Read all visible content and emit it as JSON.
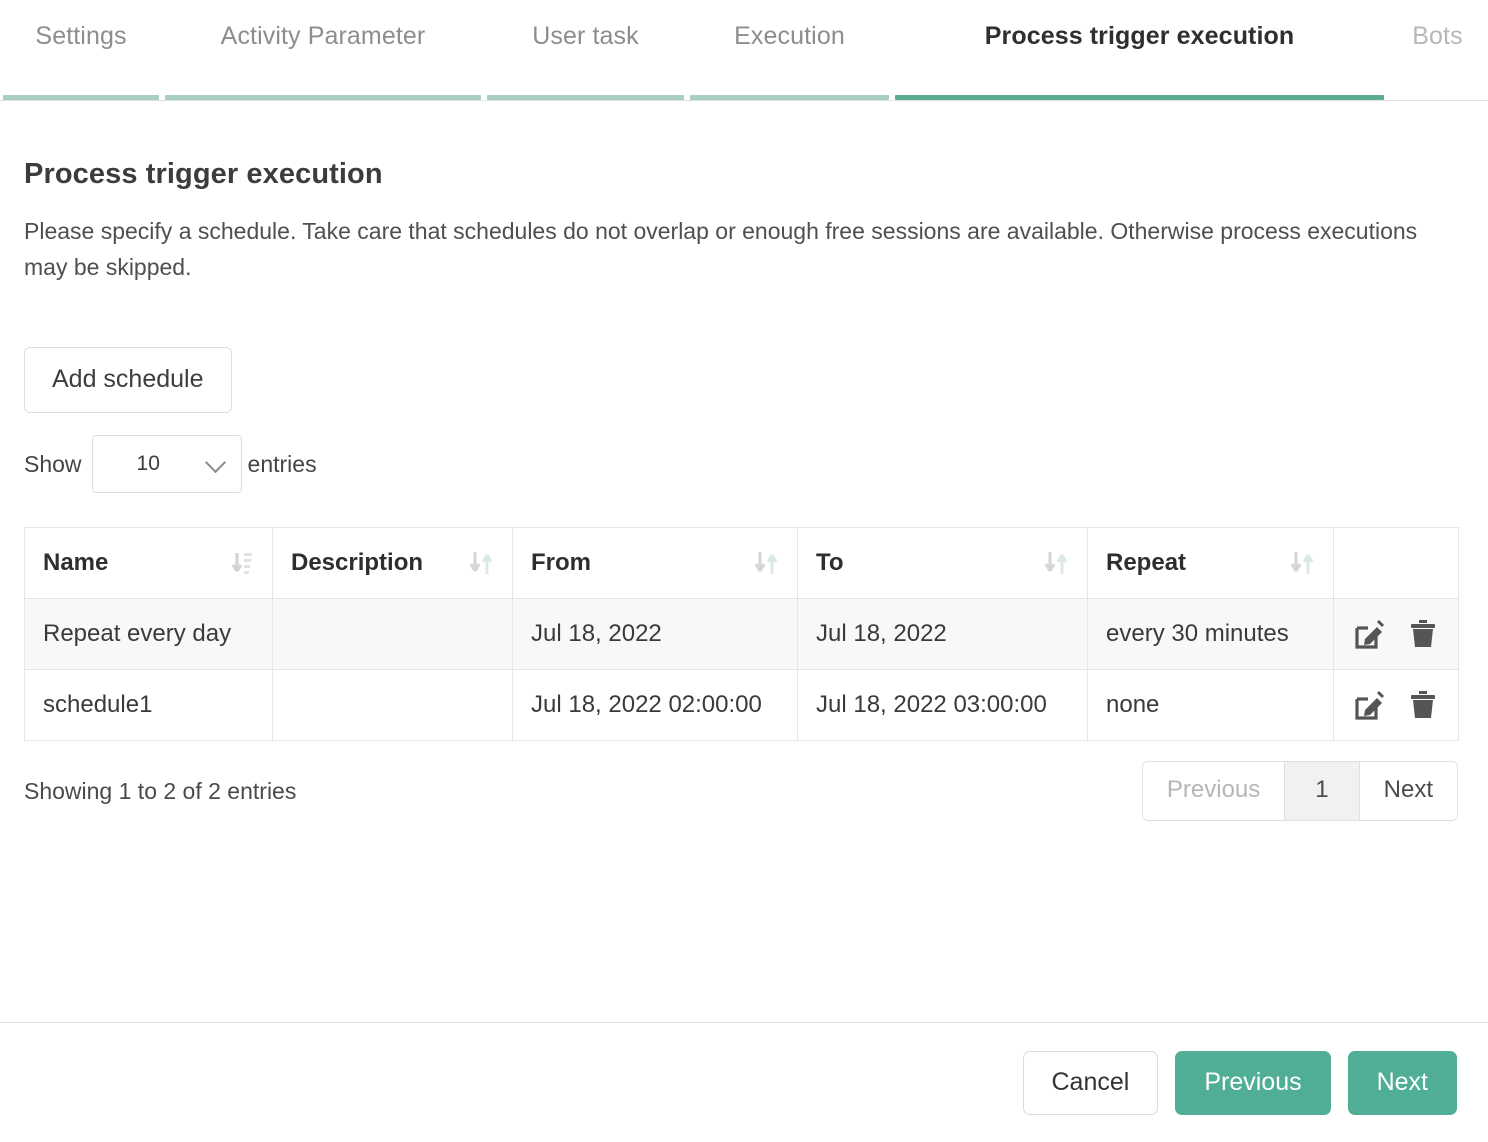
{
  "tabs": [
    {
      "label": "Settings",
      "state": "visited"
    },
    {
      "label": "Activity Parameter",
      "state": "visited"
    },
    {
      "label": "User task",
      "state": "visited"
    },
    {
      "label": "Execution",
      "state": "visited"
    },
    {
      "label": "Process trigger execution",
      "state": "active"
    },
    {
      "label": "Bots",
      "state": "muted"
    }
  ],
  "page": {
    "title": "Process trigger execution",
    "description": "Please specify a schedule. Take care that schedules do not overlap or enough free sessions are available. Otherwise process executions may be skipped."
  },
  "toolbar": {
    "add_schedule_label": "Add schedule"
  },
  "length_menu": {
    "prefix": "Show",
    "value": "10",
    "suffix": "entries",
    "chevron_icon": "chevron-down-icon"
  },
  "table": {
    "columns": [
      {
        "label": "Name",
        "sort_icon": "sort-amount-down-icon"
      },
      {
        "label": "Description",
        "sort_icon": "sort-icon"
      },
      {
        "label": "From",
        "sort_icon": "sort-icon"
      },
      {
        "label": "To",
        "sort_icon": "sort-icon"
      },
      {
        "label": "Repeat",
        "sort_icon": "sort-icon"
      },
      {
        "label": "",
        "sort_icon": ""
      }
    ],
    "rows": [
      {
        "name": "Repeat every day",
        "description": "",
        "from": "Jul 18, 2022",
        "to": "Jul 18, 2022",
        "repeat": "every 30 minutes",
        "edit_icon": "edit-icon",
        "delete_icon": "trash-icon"
      },
      {
        "name": "schedule1",
        "description": "",
        "from": "Jul 18, 2022 02:00:00",
        "to": "Jul 18, 2022 03:00:00",
        "repeat": "none",
        "edit_icon": "edit-icon",
        "delete_icon": "trash-icon"
      }
    ]
  },
  "table_footer": {
    "showing_text": "Showing 1 to 2 of 2 entries",
    "pagination": {
      "previous_label": "Previous",
      "page_label": "1",
      "next_label": "Next"
    }
  },
  "footer": {
    "cancel_label": "Cancel",
    "previous_label": "Previous",
    "next_label": "Next"
  },
  "colors": {
    "accent_green": "#4fae95",
    "tab_active_underline": "#5cab94",
    "tab_visited_underline": "#a8cfc2",
    "row_stripe": "#f8f8f8",
    "border": "#e6e6e6"
  }
}
